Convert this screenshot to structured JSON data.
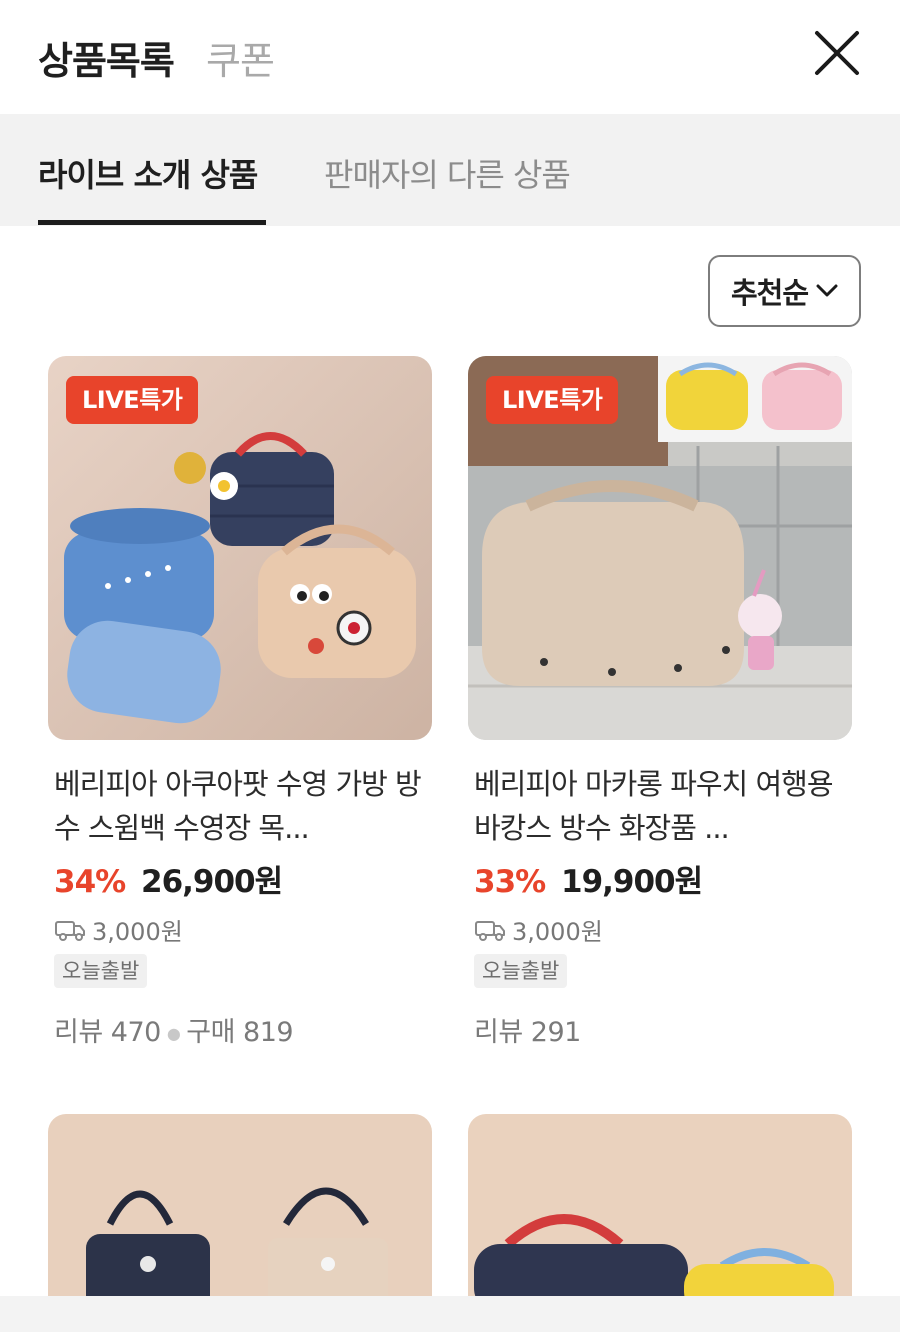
{
  "header": {
    "tab_active": "상품목록",
    "tab_inactive": "쿠폰"
  },
  "subtabs": {
    "active": "라이브 소개 상품",
    "inactive": "판매자의 다른 상품"
  },
  "sort": {
    "label": "추천순"
  },
  "products": [
    {
      "badge": "LIVE특가",
      "title": "베리피아 아쿠아팟 수영 가방 방수 스윔백 수영장 목...",
      "discount": "34%",
      "price": "26,900원",
      "shipping": "3,000원",
      "tag": "오늘출발",
      "review_label": "리뷰 470",
      "purchase_label": "구매 819"
    },
    {
      "badge": "LIVE특가",
      "title": "베리피아 마카롱 파우치 여행용 바캉스 방수 화장품 ...",
      "discount": "33%",
      "price": "19,900원",
      "shipping": "3,000원",
      "tag": "오늘출발",
      "review_label": "리뷰 291"
    }
  ],
  "colors": {
    "accent": "#e8442b",
    "subtab_bg": "#f2f2f2"
  }
}
